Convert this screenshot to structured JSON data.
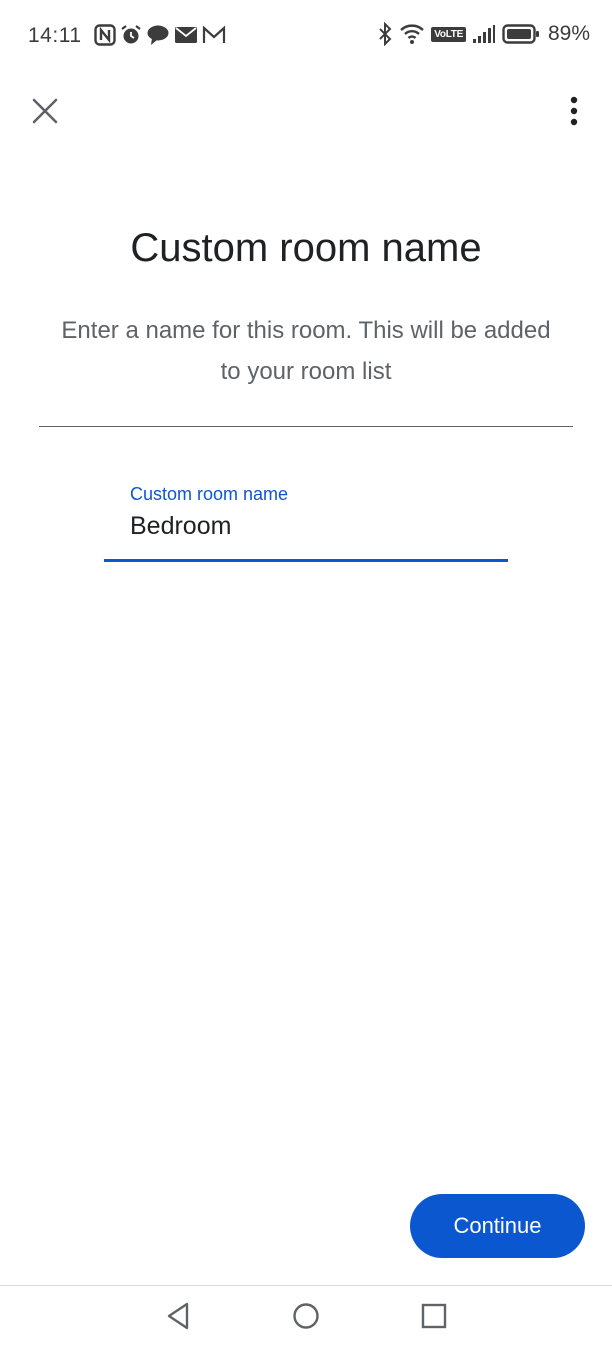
{
  "status_bar": {
    "time": "14:11",
    "battery_percent": "89%",
    "network_label": "VoLTE",
    "notification_icons": [
      "nfc-icon",
      "alarm-icon",
      "chat-icon",
      "email-icon",
      "gmail-icon"
    ],
    "system_icons": [
      "bluetooth-icon",
      "wifi-icon",
      "volte-icon",
      "signal-icon",
      "battery-icon"
    ]
  },
  "header": {
    "close_icon": "close-icon",
    "more_icon": "more-vert-icon"
  },
  "main": {
    "title": "Custom room name",
    "description": "Enter a name for this room. This will be added to your room list",
    "field": {
      "label": "Custom room name",
      "value": "Bedroom"
    },
    "continue_label": "Continue"
  },
  "nav_bar": {
    "icons": [
      "back-icon",
      "home-icon",
      "recents-icon"
    ]
  },
  "colors": {
    "accent": "#0b57d0",
    "text_primary": "#202124",
    "text_secondary": "#5f6368"
  }
}
